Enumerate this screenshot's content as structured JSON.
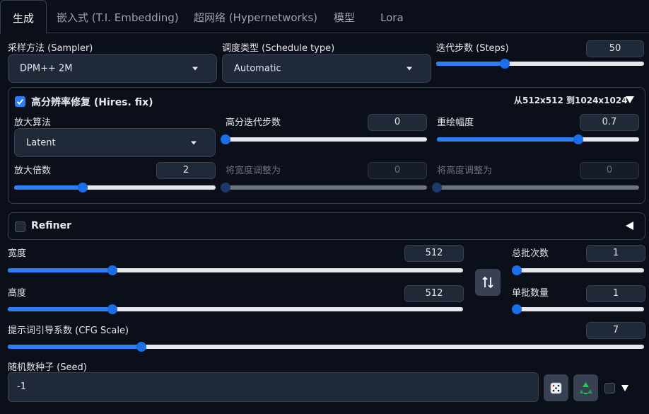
{
  "tabs": [
    "生成",
    "嵌入式 (T.I. Embedding)",
    "超网络 (Hypernetworks)",
    "模型",
    "Lora"
  ],
  "sampler": {
    "label": "采样方法 (Sampler)",
    "value": "DPM++ 2M"
  },
  "schedule": {
    "label": "调度类型 (Schedule type)",
    "value": "Automatic"
  },
  "steps": {
    "label": "迭代步数 (Steps)",
    "value": "50",
    "fraction": 0.33
  },
  "hires": {
    "label": "高分辨率修复 (Hires. fix)",
    "checked": true,
    "resolution_text": "从512x512 到1024x1024",
    "collapse_icon": "triangle-down",
    "upscaler": {
      "label": "放大算法",
      "value": "Latent"
    },
    "hires_steps": {
      "label": "高分迭代步数",
      "value": "0",
      "fraction": 0.0
    },
    "denoise": {
      "label": "重绘幅度",
      "value": "0.7",
      "fraction": 0.7
    },
    "upscale_by": {
      "label": "放大倍数",
      "value": "2",
      "fraction": 0.34
    },
    "resize_width": {
      "label": "将宽度调整为",
      "value": "0",
      "fraction": 0.0
    },
    "resize_height": {
      "label": "将高度调整为",
      "value": "0",
      "fraction": 0.0
    }
  },
  "refiner": {
    "label": "Refiner",
    "checked": false,
    "expand_icon": "triangle-left"
  },
  "width": {
    "label": "宽度",
    "value": "512",
    "fraction": 0.23
  },
  "height": {
    "label": "高度",
    "value": "512",
    "fraction": 0.23
  },
  "swap_icon": "swap-arrows",
  "batch_count": {
    "label": "总批次数",
    "value": "1",
    "fraction": 0.0
  },
  "batch_size": {
    "label": "单批数量",
    "value": "1",
    "fraction": 0.0
  },
  "cfg": {
    "label": "提示词引导系数 (CFG Scale)",
    "value": "7",
    "fraction": 0.21
  },
  "seed": {
    "label": "随机数种子 (Seed)",
    "value": "-1"
  },
  "icons": {
    "dice": "dice-icon",
    "recycle": "recycle-icon"
  },
  "colors": {
    "accent": "#2b7ef4",
    "background": "#0b0f19",
    "panel": "#1f2937",
    "border": "#374151"
  }
}
